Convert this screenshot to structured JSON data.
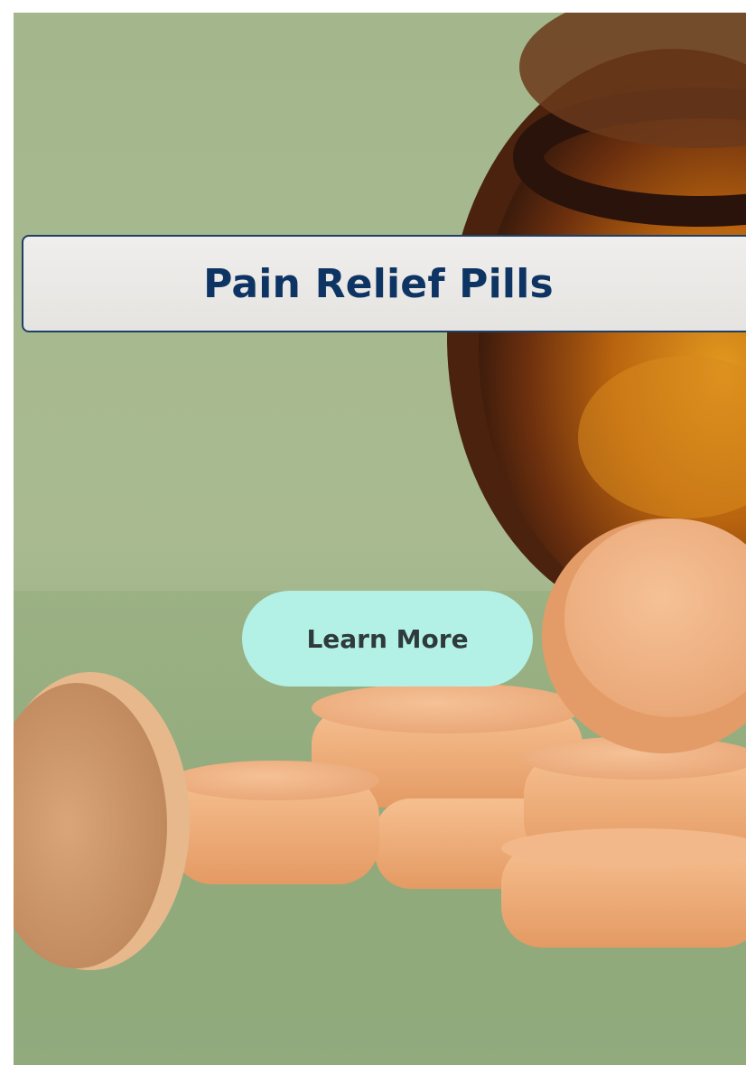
{
  "banner": {
    "title": "Pain Relief Pills"
  },
  "cta": {
    "label": "Learn More"
  },
  "colors": {
    "background_green": "#a4b78c",
    "banner_bg": "#e9e8e6",
    "banner_border": "#1f3f66",
    "title_text": "#0d3463",
    "button_bg": "#b3f1e6",
    "button_text": "#2f3a3c",
    "tablet": "#eeaa76",
    "bottle_amber": "#7a3a12"
  }
}
